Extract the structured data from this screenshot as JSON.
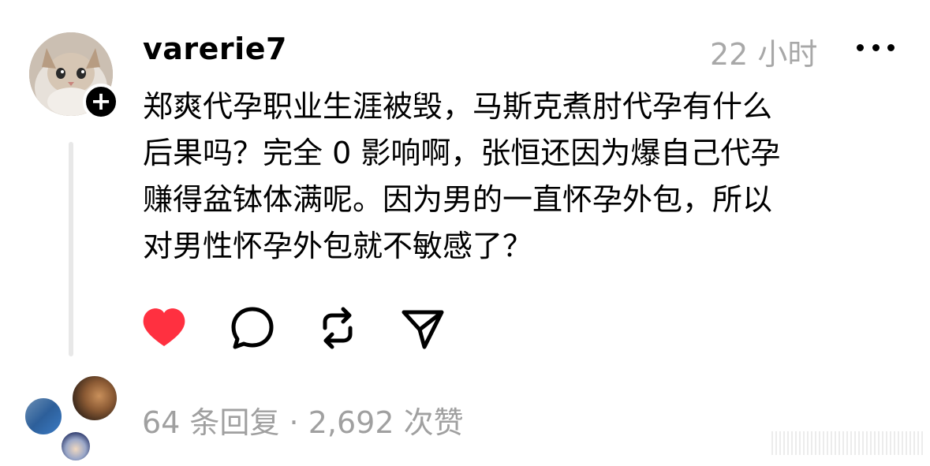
{
  "post": {
    "username": "varerie7",
    "timestamp": "22 小时",
    "text": "郑爽代孕职业生涯被毁，马斯克煮肘代孕有什么\n后果吗？完全 0 影响啊，张恒还因为爆自己代孕\n赚得盆钵体满呢。因为男的一直怀孕外包，所以\n对男性怀孕外包就不敏感了？",
    "replies_label": "64 条回复",
    "separator": "·",
    "likes_label": "2,692 次赞"
  },
  "icons": {
    "follow": "+",
    "like": "heart-icon",
    "comment": "comment-bubble-icon",
    "repost": "repost-icon",
    "share": "paper-plane-icon",
    "more": "more-icon"
  },
  "colors": {
    "like_red": "#ff3040",
    "muted_gray": "#a8a8a8",
    "text_black": "#000000"
  }
}
